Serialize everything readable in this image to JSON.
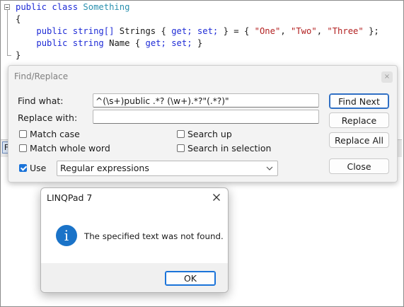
{
  "editor": {
    "line1": {
      "kw1": "public",
      "kw2": "class",
      "type": "Something"
    },
    "line2": {
      "brace": "{"
    },
    "line3": {
      "kw1": "public",
      "kw2": "string[]",
      "name": "Strings",
      "open": "{",
      "get": "get;",
      "set": "set;",
      "close": "} = {",
      "s1": "\"One\"",
      "c1": ",",
      "s2": "\"Two\"",
      "c2": ",",
      "s3": "\"Three\"",
      "end": "};"
    },
    "line4": {
      "kw1": "public",
      "kw2": "string",
      "name": "Name",
      "open": "{",
      "get": "get;",
      "set": "set;",
      "close": "}"
    },
    "line5": {
      "brace": "}"
    }
  },
  "background_tab": {
    "label": "F"
  },
  "find_replace": {
    "title": "Find/Replace",
    "close_glyph": "×",
    "find_label": "Find what:",
    "find_value": "^(\\s+)public .*? (\\w+).*?\"(.*?)\"",
    "replace_label": "Replace with:",
    "replace_value": "",
    "options": {
      "match_case": {
        "label": "Match case",
        "checked": false
      },
      "match_whole_word": {
        "label": "Match whole word",
        "checked": false
      },
      "search_up": {
        "label": "Search up",
        "checked": false
      },
      "search_in_selection": {
        "label": "Search in selection",
        "checked": false
      },
      "use": {
        "label": "Use",
        "checked": true
      }
    },
    "mode_select": {
      "value": "Regular expressions"
    },
    "buttons": {
      "find_next": "Find Next",
      "replace": "Replace",
      "replace_all": "Replace All",
      "close": "Close"
    }
  },
  "message_box": {
    "title": "LINQPad 7",
    "icon": "info-icon",
    "icon_glyph": "i",
    "text": "The specified text was not found.",
    "ok_label": "OK"
  },
  "colors": {
    "accent": "#1a73d9",
    "keyword": "#1e2bd6",
    "type": "#2b91af",
    "string": "#b32222"
  }
}
